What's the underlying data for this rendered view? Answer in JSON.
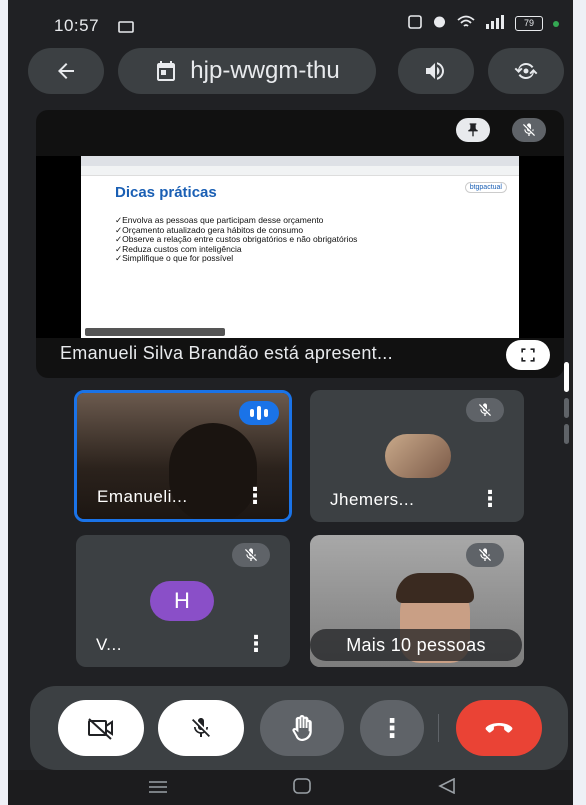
{
  "status_bar": {
    "time": "10:57",
    "battery": "79"
  },
  "meeting": {
    "code": "hjp-wwgm-thu"
  },
  "presentation": {
    "label": "Emanueli Silva Brandão está apresent...",
    "slide": {
      "title": "Dicas práticas",
      "logo": "btgpactual",
      "bullets": [
        "Envolva as pessoas que participam desse orçamento",
        "Orçamento atualizado gera hábitos de consumo",
        "Observe a relação entre custos obrigatórios e não obrigatórios",
        "Reduza custos com inteligência",
        "Simplifique o que for possível"
      ]
    }
  },
  "participants": [
    {
      "name": "Emanueli...",
      "speaking": true
    },
    {
      "name": "Jhemers...",
      "muted": true
    },
    {
      "name": "V...",
      "initial": "H",
      "muted": true
    },
    {
      "name": "Mais 10 pessoas",
      "muted": true
    }
  ],
  "colors": {
    "accent": "#1a73e8",
    "end_call": "#ea4335",
    "surface": "#3c4043",
    "avatar": "#8a4fc8"
  },
  "icons": [
    "back-arrow-icon",
    "calendar-icon",
    "speaker-icon",
    "flip-camera-icon",
    "pin-icon",
    "mic-off-icon",
    "fullscreen-icon",
    "camera-off-icon",
    "raise-hand-icon",
    "more-vert-icon",
    "end-call-icon"
  ]
}
